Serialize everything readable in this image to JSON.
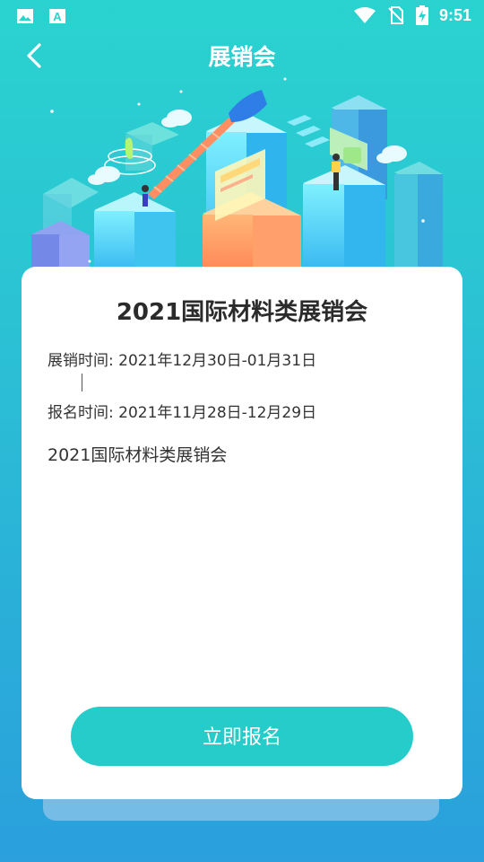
{
  "status_bar": {
    "time": "9:51",
    "notif_icon_letter": "A"
  },
  "header": {
    "title": "展销会"
  },
  "event": {
    "name": "2021国际材料类展销会",
    "exhibit_time_label": "展销时间:",
    "exhibit_time_value": "2021年12月30日-01月31日",
    "register_time_label": "报名时间:",
    "register_time_value": "2021年11月28日-12月29日",
    "description": "2021国际材料类展销会"
  },
  "actions": {
    "register_label": "立即报名"
  },
  "colors": {
    "accent": "#26ccc9",
    "bg_top": "#2ad3cf",
    "bg_bottom": "#2a9fdc"
  }
}
